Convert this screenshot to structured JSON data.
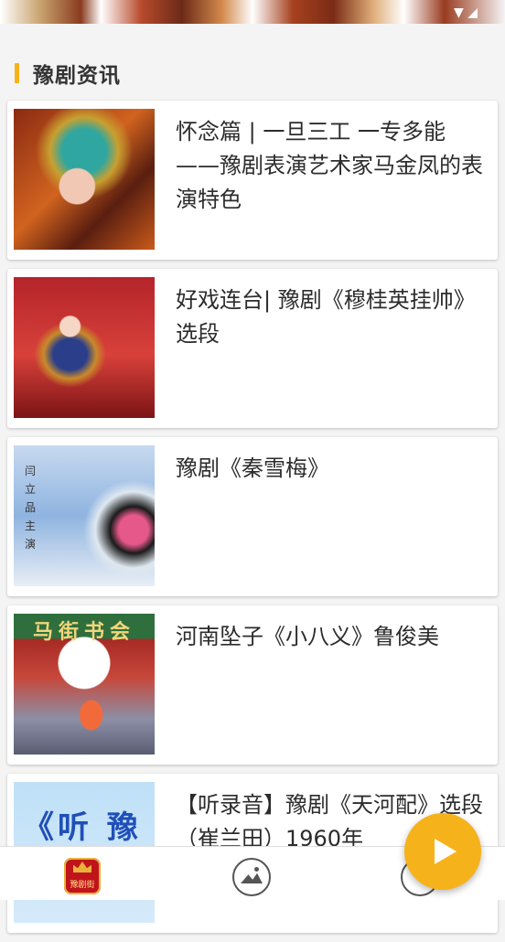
{
  "section": {
    "title": "豫剧资讯"
  },
  "articles": [
    {
      "title": "怀念篇 | 一旦三工 一专多能——豫剧表演艺术家马金凤的表演特色"
    },
    {
      "title": "好戏连台| 豫剧《穆桂英挂帅》选段"
    },
    {
      "title": "豫剧《秦雪梅》",
      "thumb_text": "闫立品主演"
    },
    {
      "title": "河南坠子《小八义》鲁俊美",
      "thumb_text": "马街书会"
    },
    {
      "title": "【听录音】豫剧《天河配》选段（崔兰田）1960年",
      "thumb_text": "《听 豫"
    }
  ],
  "nav": {
    "home_logo_text": "豫剧街",
    "items": [
      {
        "icon": "home-logo-icon"
      },
      {
        "icon": "gallery-icon"
      },
      {
        "icon": "circle-icon"
      }
    ]
  },
  "fab": {
    "icon": "play-icon"
  },
  "colors": {
    "accent": "#f6b21a",
    "card_bg": "#ffffff",
    "page_bg": "#f4f4f4"
  }
}
